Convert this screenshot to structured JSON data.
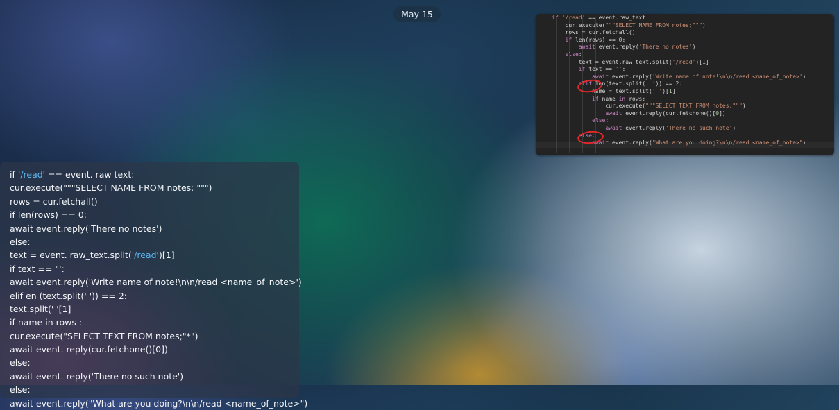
{
  "date_label": "May 15",
  "code_screenshot": {
    "lines": [
      [
        {
          "t": "    ",
          "c": ""
        },
        {
          "t": "if",
          "c": "kw"
        },
        {
          "t": " ",
          "c": ""
        },
        {
          "t": "'/read'",
          "c": "str"
        },
        {
          "t": " == event.raw_text:",
          "c": ""
        }
      ],
      [
        {
          "t": "        cur.execute(",
          "c": ""
        },
        {
          "t": "\"\"\"SELECT NAME FROM notes;\"\"\"",
          "c": "str"
        },
        {
          "t": ")",
          "c": ""
        }
      ],
      [
        {
          "t": "        rows = cur.fetchall()",
          "c": ""
        }
      ],
      [
        {
          "t": "        ",
          "c": ""
        },
        {
          "t": "if",
          "c": "kw"
        },
        {
          "t": " len(rows) == ",
          "c": ""
        },
        {
          "t": "0",
          "c": "num"
        },
        {
          "t": ":",
          "c": ""
        }
      ],
      [
        {
          "t": "            ",
          "c": ""
        },
        {
          "t": "await",
          "c": "kw"
        },
        {
          "t": " event.reply(",
          "c": ""
        },
        {
          "t": "'There no notes'",
          "c": "str"
        },
        {
          "t": ")",
          "c": ""
        }
      ],
      [
        {
          "t": "        ",
          "c": ""
        },
        {
          "t": "else",
          "c": "kw"
        },
        {
          "t": ":",
          "c": ""
        }
      ],
      [
        {
          "t": "            text = event.raw_text.split(",
          "c": ""
        },
        {
          "t": "'/read'",
          "c": "str"
        },
        {
          "t": ")[",
          "c": ""
        },
        {
          "t": "1",
          "c": "num"
        },
        {
          "t": "]",
          "c": ""
        }
      ],
      [
        {
          "t": "            ",
          "c": ""
        },
        {
          "t": "if",
          "c": "kw"
        },
        {
          "t": " text == ",
          "c": ""
        },
        {
          "t": "''",
          "c": "str"
        },
        {
          "t": ":",
          "c": ""
        }
      ],
      [
        {
          "t": "                ",
          "c": ""
        },
        {
          "t": "await",
          "c": "kw"
        },
        {
          "t": " event.reply(",
          "c": ""
        },
        {
          "t": "'Write name of note!\\n\\n/read <name_of_note>'",
          "c": "str"
        },
        {
          "t": ")",
          "c": ""
        }
      ],
      [
        {
          "t": "            ",
          "c": ""
        },
        {
          "t": "elif",
          "c": "kw"
        },
        {
          "t": " len(text.split(",
          "c": ""
        },
        {
          "t": "' '",
          "c": "str"
        },
        {
          "t": ")) == ",
          "c": ""
        },
        {
          "t": "2",
          "c": "num"
        },
        {
          "t": ":",
          "c": ""
        }
      ],
      [
        {
          "t": "                name = text.split(",
          "c": ""
        },
        {
          "t": "' '",
          "c": "str"
        },
        {
          "t": ")[",
          "c": ""
        },
        {
          "t": "1",
          "c": "num"
        },
        {
          "t": "]",
          "c": ""
        }
      ],
      [
        {
          "t": "                ",
          "c": ""
        },
        {
          "t": "if",
          "c": "kw"
        },
        {
          "t": " name ",
          "c": ""
        },
        {
          "t": "in",
          "c": "kw"
        },
        {
          "t": " rows:",
          "c": ""
        }
      ],
      [
        {
          "t": "                    cur.execute(",
          "c": ""
        },
        {
          "t": "\"\"\"SELECT TEXT FROM notes;\"\"\"",
          "c": "str"
        },
        {
          "t": ")",
          "c": ""
        }
      ],
      [
        {
          "t": "                    ",
          "c": ""
        },
        {
          "t": "await",
          "c": "kw"
        },
        {
          "t": " event.reply(cur.fetchone()[",
          "c": ""
        },
        {
          "t": "0",
          "c": "num"
        },
        {
          "t": "])",
          "c": ""
        }
      ],
      [
        {
          "t": "                ",
          "c": ""
        },
        {
          "t": "else",
          "c": "kw"
        },
        {
          "t": ":",
          "c": ""
        }
      ],
      [
        {
          "t": "                    ",
          "c": ""
        },
        {
          "t": "await",
          "c": "kw"
        },
        {
          "t": " event.reply(",
          "c": ""
        },
        {
          "t": "'There no such note'",
          "c": "str"
        },
        {
          "t": ")",
          "c": ""
        }
      ],
      [
        {
          "t": "            ",
          "c": ""
        },
        {
          "t": "else",
          "c": "kw"
        },
        {
          "t": ":",
          "c": ""
        }
      ],
      [
        {
          "t": "                ",
          "c": ""
        },
        {
          "t": "await",
          "c": "kw"
        },
        {
          "t": " event.reply(",
          "c": ""
        },
        {
          "t": "\"What are you doing?\\n\\n/read <name_of_note>\"",
          "c": "str"
        },
        {
          "t": ")",
          "c": ""
        }
      ]
    ],
    "annotation_color": "#e0272a"
  },
  "message_lines": [
    [
      {
        "t": "if '",
        "l": false
      },
      {
        "t": "/read",
        "l": true
      },
      {
        "t": "' == event. raw text:",
        "l": false
      }
    ],
    [
      {
        "t": "cur.execute(\"\"\"SELECT NAME FROM notes; \"\"\")",
        "l": false
      }
    ],
    [
      {
        "t": "rows = cur.fetchall()",
        "l": false
      }
    ],
    [
      {
        "t": "if len(rows) == 0:",
        "l": false
      }
    ],
    [
      {
        "t": "await event.reply('There no notes')",
        "l": false
      }
    ],
    [
      {
        "t": "else:",
        "l": false
      }
    ],
    [
      {
        "t": "text = event. raw_text.split('",
        "l": false
      },
      {
        "t": "/read",
        "l": true
      },
      {
        "t": "')[1]",
        "l": false
      }
    ],
    [
      {
        "t": "if text == \"':",
        "l": false
      }
    ],
    [
      {
        "t": "await event.reply('Write name of note!\\n\\n/read <name_of_note>')",
        "l": false
      }
    ],
    [
      {
        "t": "elif en (text.split(' ')) == 2:",
        "l": false
      }
    ],
    [
      {
        "t": "text.split(' '[1]",
        "l": false
      }
    ],
    [
      {
        "t": "if name in rows :",
        "l": false
      }
    ],
    [
      {
        "t": "cur.execute(\"SELECT TEXT FROM notes;\"*\")",
        "l": false
      }
    ],
    [
      {
        "t": "await event. reply(cur.fetchone()[0])",
        "l": false
      }
    ],
    [
      {
        "t": "else:",
        "l": false
      }
    ],
    [
      {
        "t": "await event. reply('There no such note')",
        "l": false
      }
    ],
    [
      {
        "t": "else:",
        "l": false
      }
    ],
    [
      {
        "t": "await event.reply(\"What are you doing?\\n\\n/read <name_of_note>\")",
        "l": false
      }
    ]
  ],
  "colors": {
    "link": "#5cb8f0",
    "code_bg": "#232323",
    "keyword": "#c586c0",
    "string": "#ce9178"
  }
}
